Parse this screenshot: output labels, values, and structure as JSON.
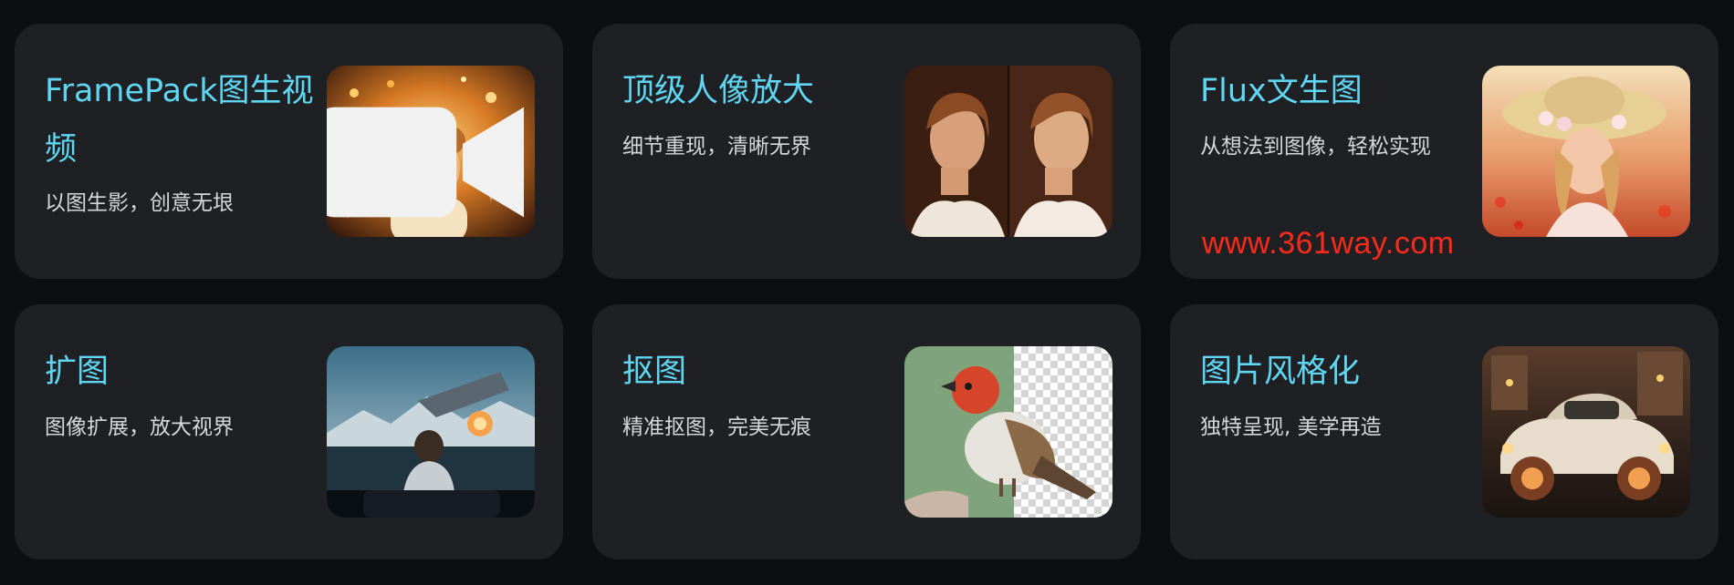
{
  "cards": [
    {
      "title": "FramePack图生视频",
      "subtitle": "以图生影，创意无垠",
      "image": "boy-with-ice-cream-fireworks",
      "badge_icon": "video-camera-icon"
    },
    {
      "title": "顶级人像放大",
      "subtitle": "细节重现，清晰无界",
      "image": "woman-portrait-before-after"
    },
    {
      "title": "Flux文生图",
      "subtitle": "从想法到图像，轻松实现",
      "image": "girl-in-straw-hat-flower-field",
      "watermark": "www.361way.com"
    },
    {
      "title": "扩图",
      "subtitle": "图像扩展，放大视界",
      "image": "person-watching-sci-fi-screen"
    },
    {
      "title": "抠图",
      "subtitle": "精准抠图，完美无痕",
      "image": "red-headed-bird-cutout"
    },
    {
      "title": "图片风格化",
      "subtitle": "独特呈现, 美学再造",
      "image": "stylized-vintage-car"
    }
  ],
  "colors": {
    "page_background": "#0c0f12",
    "card_background": "#1f2023",
    "title": "#5fd6f2",
    "subtitle": "#d6d7d9",
    "watermark": "#ff2a1a"
  }
}
